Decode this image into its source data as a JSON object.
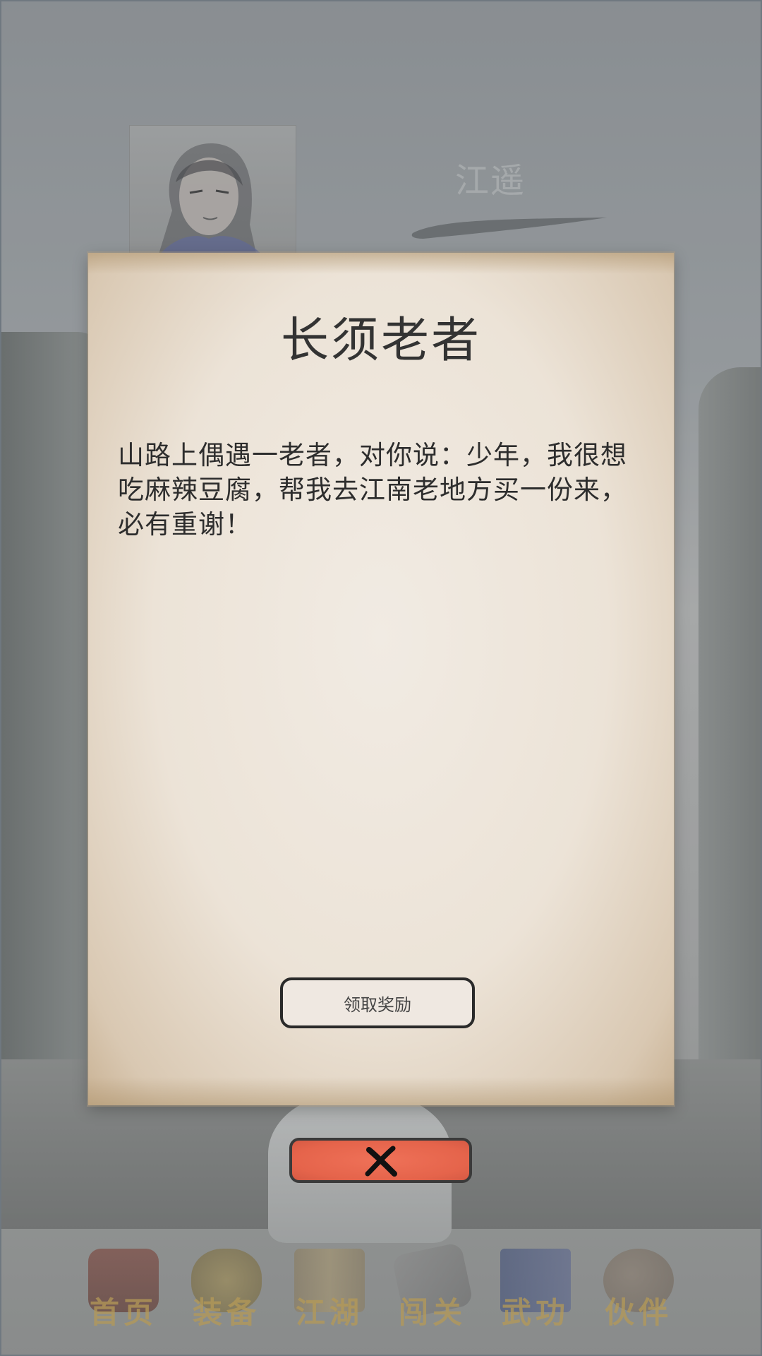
{
  "character": {
    "name": "江遥"
  },
  "dialog": {
    "title": "长须老者",
    "body": "山路上偶遇一老者，对你说：少年，我很想吃麻辣豆腐，帮我去江南老地方买一份来，必有重谢！",
    "claim_button": "领取奖励"
  },
  "close_button": {
    "icon": "close-x-icon"
  },
  "bottom_nav": {
    "items": [
      {
        "label": "首页",
        "icon": "house-icon"
      },
      {
        "label": "装备",
        "icon": "armor-icon"
      },
      {
        "label": "江湖",
        "icon": "scroll-map-icon"
      },
      {
        "label": "闯关",
        "icon": "crossed-swords-icon"
      },
      {
        "label": "武功",
        "icon": "book-icon"
      },
      {
        "label": "伙伴",
        "icon": "companions-icon"
      }
    ]
  },
  "colors": {
    "accent": "#e5644b",
    "nav_label": "#b59a57",
    "parchment": "#ece3d7"
  }
}
